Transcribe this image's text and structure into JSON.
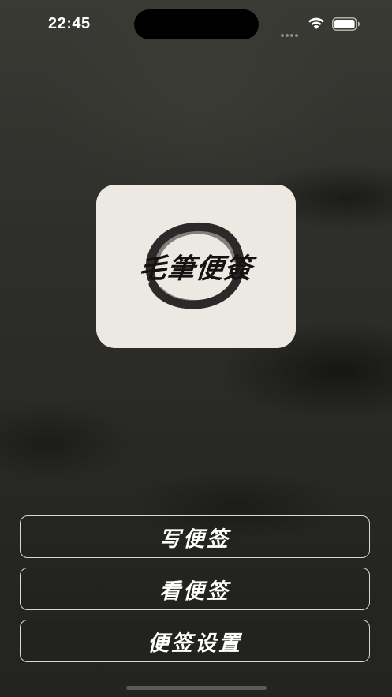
{
  "status_bar": {
    "time": "22:45",
    "icons": [
      "signal-dots-icon",
      "wifi-icon",
      "battery-icon"
    ]
  },
  "logo": {
    "text": "毛筆便簽",
    "card_color": "#ece9e2",
    "ink_color": "#141312"
  },
  "menu": {
    "write_label": "写便签",
    "view_label": "看便签",
    "settings_label": "便签设置"
  },
  "colors": {
    "background": "#2b2b27",
    "button_border": "#d8d8d2",
    "button_text": "#ffffff"
  }
}
